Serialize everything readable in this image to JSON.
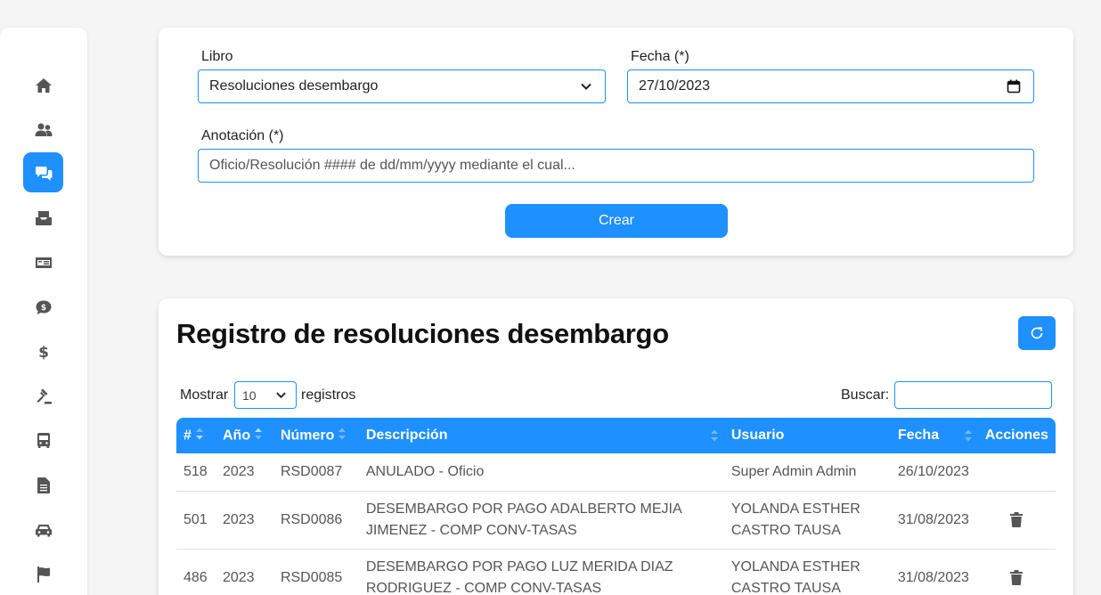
{
  "sidebar": {
    "items": [
      {
        "icon": "home-icon",
        "active": false
      },
      {
        "icon": "users-icon",
        "active": false
      },
      {
        "icon": "comments-icon",
        "active": true
      },
      {
        "icon": "inbox-icon",
        "active": false
      },
      {
        "icon": "money-bill-icon",
        "active": false
      },
      {
        "icon": "comment-dollar-icon",
        "active": false
      },
      {
        "icon": "dollar-icon",
        "active": false
      },
      {
        "icon": "gavel-icon",
        "active": false
      },
      {
        "icon": "bus-icon",
        "active": false
      },
      {
        "icon": "file-text-icon",
        "active": false
      },
      {
        "icon": "car-icon",
        "active": false
      },
      {
        "icon": "flag-icon",
        "active": false
      }
    ]
  },
  "form": {
    "libro_label": "Libro",
    "libro_value": "Resoluciones desembargo",
    "fecha_label": "Fecha (*)",
    "fecha_value": "27/10/2023",
    "anotacion_label": "Anotación (*)",
    "anotacion_placeholder": "Oficio/Resolución #### de dd/mm/yyyy mediante el cual...",
    "crear_label": "Crear"
  },
  "table_section": {
    "title": "Registro de resoluciones desembargo",
    "mostrar_label": "Mostrar",
    "length_value": "10",
    "registros_label": "registros",
    "buscar_label": "Buscar:",
    "buscar_value": "",
    "columns": [
      "#",
      "Año",
      "Número",
      "Descripción",
      "Usuario",
      "Fecha",
      "Acciones"
    ],
    "rows": [
      {
        "num": "518",
        "anio": "2023",
        "numero": "RSD0087",
        "descripcion": "ANULADO - Oficio",
        "usuario": "Super Admin Admin",
        "fecha": "26/10/2023",
        "delete": false
      },
      {
        "num": "501",
        "anio": "2023",
        "numero": "RSD0086",
        "descripcion": "DESEMBARGO POR PAGO ADALBERTO MEJIA JIMENEZ - COMP CONV-TASAS",
        "usuario": "YOLANDA ESTHER CASTRO TAUSA",
        "fecha": "31/08/2023",
        "delete": true
      },
      {
        "num": "486",
        "anio": "2023",
        "numero": "RSD0085",
        "descripcion": "DESEMBARGO POR PAGO LUZ MERIDA DIAZ RODRIGUEZ - COMP CONV-TASAS",
        "usuario": "YOLANDA ESTHER CASTRO TAUSA",
        "fecha": "31/08/2023",
        "delete": true
      }
    ]
  },
  "colors": {
    "accent": "#1e90ff",
    "background": "#f5f5f5"
  }
}
